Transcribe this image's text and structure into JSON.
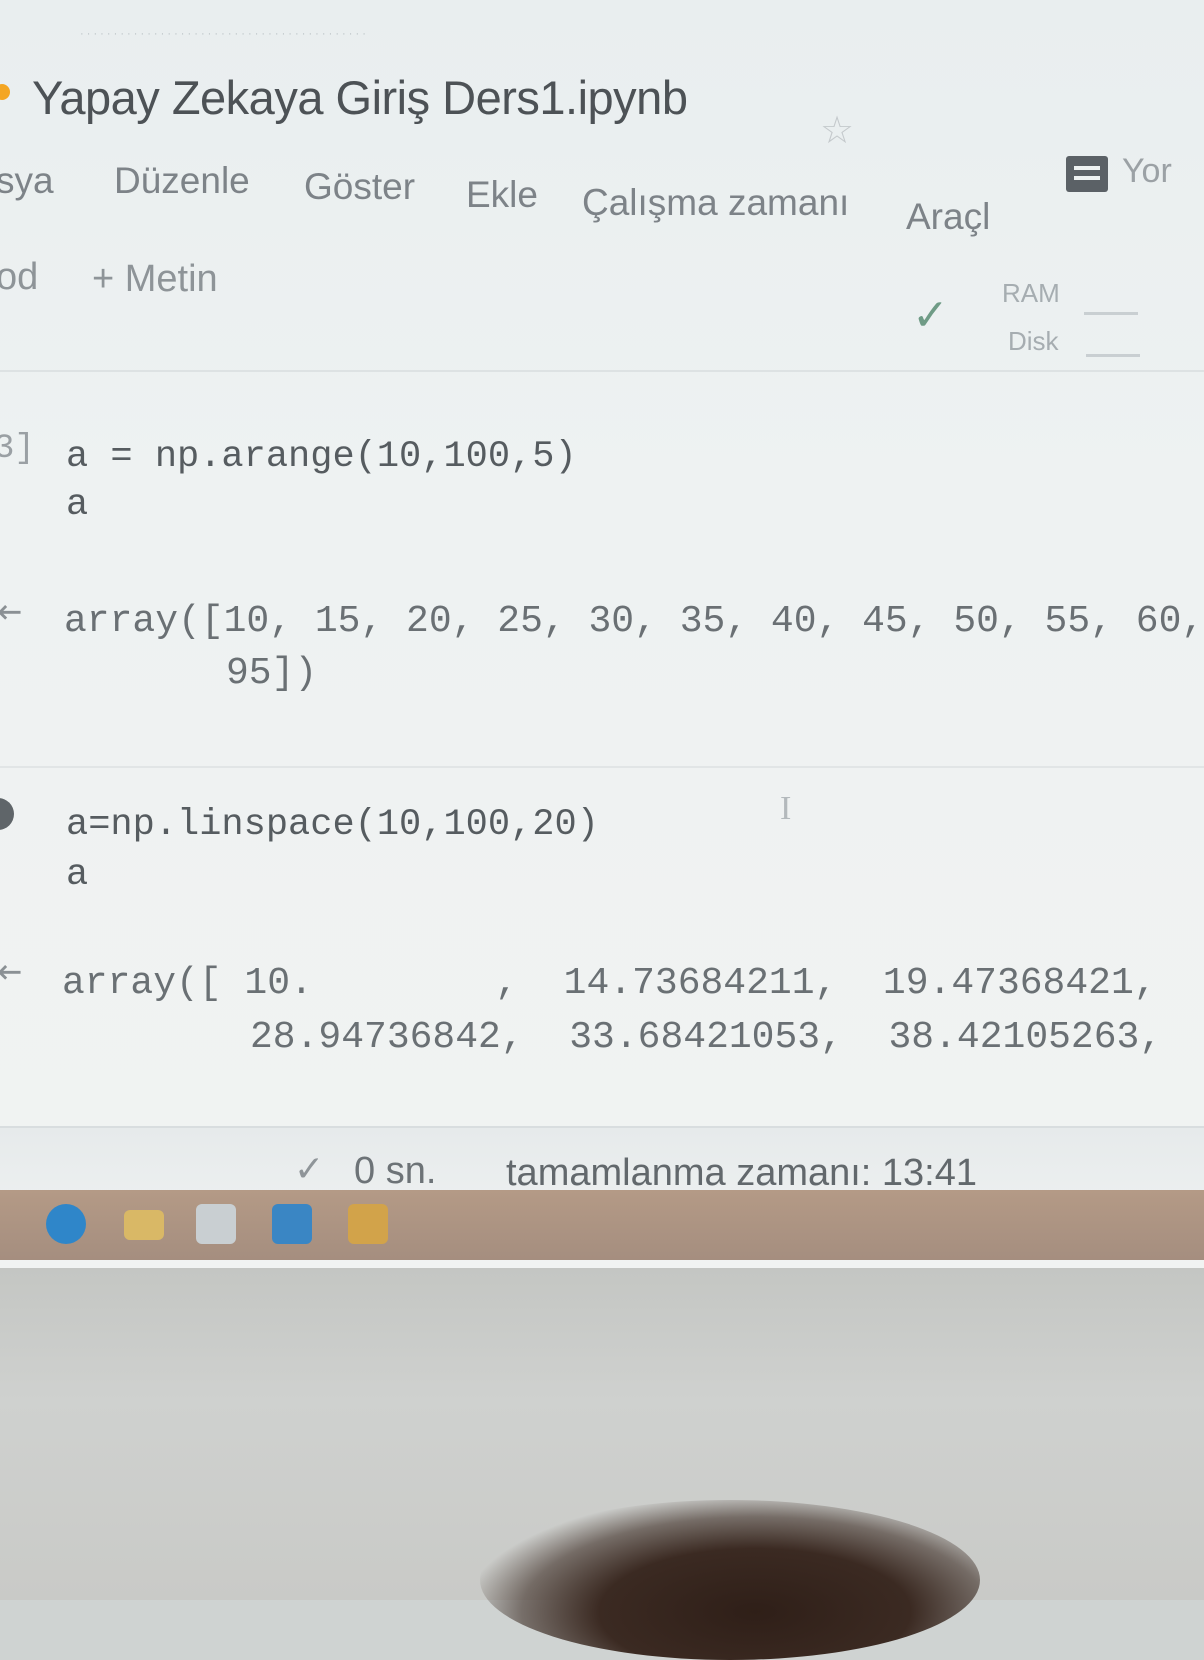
{
  "app": {
    "notebook_title": "Yapay Zekaya Giriş Ders1.ipynb",
    "comment_label": "Yor"
  },
  "menu": {
    "items": [
      {
        "label": "sya"
      },
      {
        "label": "Düzenle"
      },
      {
        "label": "Göster"
      },
      {
        "label": "Ekle"
      },
      {
        "label": "Çalışma zamanı"
      },
      {
        "label": "Araçl"
      }
    ]
  },
  "toolbar": {
    "add_code_label": "od",
    "add_text_label": "+ Metin",
    "ram_label": "RAM",
    "disk_label": "Disk"
  },
  "cells": [
    {
      "exec_count": "3]",
      "code": [
        "a = np.arange(10,100,5)",
        "a"
      ],
      "output": [
        "array([10, 15, 20, 25, 30, 35, 40, 45, 50, 55, 60,",
        "95])"
      ]
    },
    {
      "exec_count": "",
      "code": [
        "a=np.linspace(10,100,20)",
        "a"
      ],
      "output": [
        "array([ 10.        ,  14.73684211,  19.47368421,",
        "28.94736842,  33.68421053,  38.42105263,"
      ]
    }
  ],
  "status": {
    "elapsed": "0 sn.",
    "completed_at": "tamamlanma zamanı: 13:41"
  },
  "taskbar": {
    "icons": [
      {
        "name": "edge-icon",
        "color": "#2f86c9"
      },
      {
        "name": "file-explorer-icon",
        "color": "#d9b866"
      },
      {
        "name": "store-icon",
        "color": "#c9cfd2"
      },
      {
        "name": "mail-icon",
        "color": "#3a86c4"
      },
      {
        "name": "chrome-icon",
        "color": "#d2a34a"
      }
    ]
  }
}
